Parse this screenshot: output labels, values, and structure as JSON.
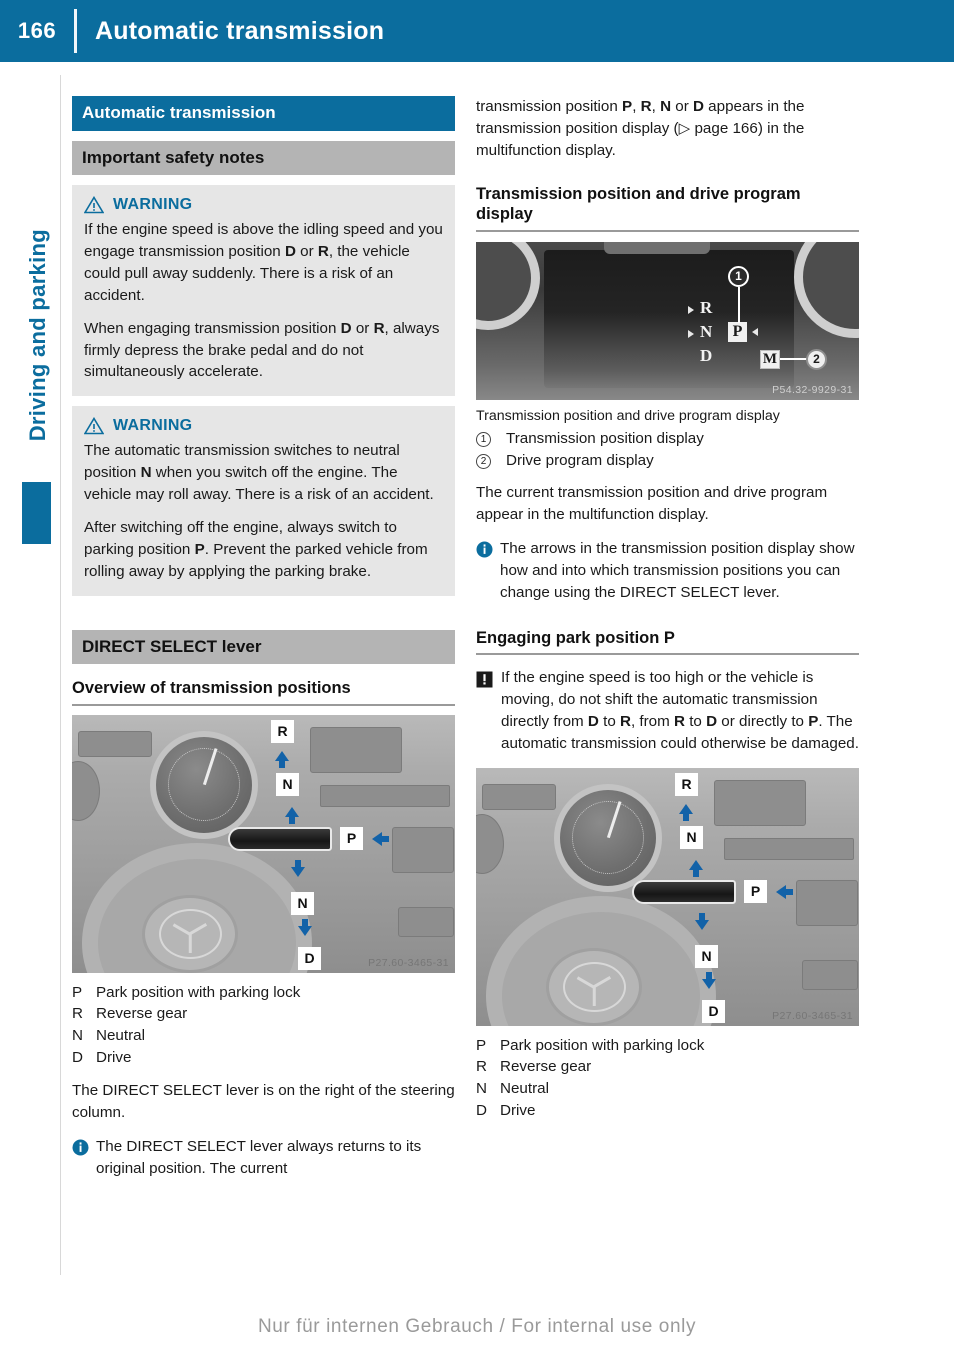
{
  "header": {
    "page_number": "166",
    "title": "Automatic transmission",
    "accent_color": "#0B6D9E"
  },
  "sidebar": {
    "chapter_label": "Driving and parking"
  },
  "left_column": {
    "section_bar": "Automatic transmission",
    "subsection_bar": "Important safety notes",
    "warning_1": {
      "label": "WARNING",
      "icon": "warning-triangle-icon",
      "paragraphs": [
        "If the engine speed is above the idling speed and you engage transmission position D or R, the vehicle could pull away suddenly. There is a risk of an accident.",
        "When engaging transmission position D or R, always firmly depress the brake pedal and do not simultaneously accelerate."
      ]
    },
    "warning_2": {
      "label": "WARNING",
      "icon": "warning-triangle-icon",
      "paragraphs": [
        "The automatic transmission switches to neutral position N when you switch off the engine. The vehicle may roll away. There is a risk of an accident.",
        "After switching off the engine, always switch to parking position P. Prevent the parked vehicle from rolling away by applying the parking brake."
      ]
    },
    "lever_bar": "DIRECT SELECT lever",
    "overview_heading": "Overview of transmission positions",
    "figure": {
      "name": "direct-select-lever-photo",
      "photo_id": "P27.60-3465-31",
      "labels": [
        "R",
        "N",
        "P",
        "N",
        "D"
      ]
    },
    "legend": [
      {
        "key": "P",
        "value": "Park position with parking lock"
      },
      {
        "key": "R",
        "value": "Reverse gear"
      },
      {
        "key": "N",
        "value": "Neutral"
      },
      {
        "key": "D",
        "value": "Drive"
      }
    ],
    "after_legend_text": "The DIRECT SELECT lever is on the right of the steering column.",
    "note": {
      "icon": "info-circle-icon",
      "text": "The DIRECT SELECT lever always returns to its original position. The current"
    }
  },
  "right_column": {
    "continuation_paragraph": "transmission position P, R, N or D appears in the transmission position display (▷ page 166) in the multifunction display.",
    "display_heading": "Transmission position and drive program display",
    "figure": {
      "name": "multifunction-display-photo",
      "photo_id": "P54.32-9929-31",
      "positions": [
        "R",
        "N",
        "D"
      ],
      "selected_position": "P",
      "drive_program": "M",
      "callouts": [
        "1",
        "2"
      ]
    },
    "figure_caption": "Transmission position and drive program display",
    "figure_legend": [
      {
        "key": "1",
        "value": "Transmission position display"
      },
      {
        "key": "2",
        "value": "Drive program display"
      }
    ],
    "body_text": "The current transmission position and drive program appear in the multifunction display.",
    "note": {
      "icon": "info-circle-icon",
      "text": "The arrows in the transmission position display show how and into which transmission positions you can change using the DIRECT SELECT lever."
    },
    "park_heading": "Engaging park position P",
    "caution": {
      "icon": "caution-exclamation-icon",
      "text": "If the engine speed is too high or the vehicle is moving, do not shift the automatic transmission directly from D to R, from R to D or directly to P. The automatic transmission could otherwise be damaged."
    },
    "figure2": {
      "name": "direct-select-lever-photo-2",
      "photo_id": "P27.60-3465-31",
      "labels": [
        "R",
        "N",
        "P",
        "N",
        "D"
      ]
    },
    "legend2": [
      {
        "key": "P",
        "value": "Park position with parking lock"
      },
      {
        "key": "R",
        "value": "Reverse gear"
      },
      {
        "key": "N",
        "value": "Neutral"
      },
      {
        "key": "D",
        "value": "Drive"
      }
    ]
  },
  "footer": {
    "text": "Nur für internen Gebrauch / For internal use only"
  }
}
